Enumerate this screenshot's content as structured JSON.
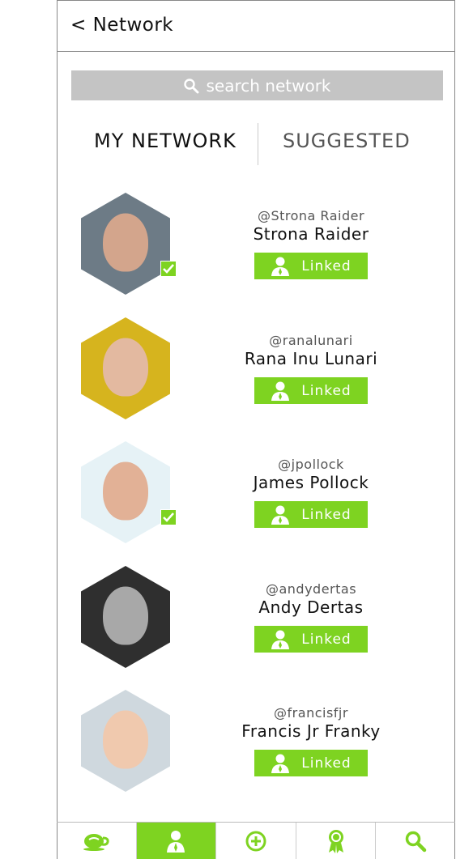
{
  "header": {
    "back_label": "< Network"
  },
  "search": {
    "placeholder": "search network"
  },
  "tabs": [
    {
      "label": "MY NETWORK",
      "active": true
    },
    {
      "label": "SUGGESTED",
      "active": false
    }
  ],
  "network": [
    {
      "handle": "@Strona Raider",
      "name": "Strona Raider",
      "button": "Linked",
      "verified": true,
      "photo_bg": "#6d7b86",
      "photo_face": "#d3a58c"
    },
    {
      "handle": "@ranalunari",
      "name": "Rana Inu Lunari",
      "button": "Linked",
      "verified": false,
      "photo_bg": "#d6b41e",
      "photo_face": "#e3b9a0"
    },
    {
      "handle": "@jpollock",
      "name": "James Pollock",
      "button": "Linked",
      "verified": true,
      "photo_bg": "#e6f2f6",
      "photo_face": "#e2b196"
    },
    {
      "handle": "@andydertas",
      "name": "Andy Dertas",
      "button": "Linked",
      "verified": false,
      "photo_bg": "#2f2f2f",
      "photo_face": "#a8a8a8"
    },
    {
      "handle": "@francisfjr",
      "name": "Francis Jr Franky",
      "button": "Linked",
      "verified": false,
      "photo_bg": "#cfd8de",
      "photo_face": "#f0c9ae"
    }
  ],
  "bottom_nav": [
    {
      "icon": "coffee-cup-icon",
      "active": false
    },
    {
      "icon": "user-network-icon",
      "active": true
    },
    {
      "icon": "plus-circle-icon",
      "active": false
    },
    {
      "icon": "award-ribbon-icon",
      "active": false
    },
    {
      "icon": "search-icon",
      "active": false
    }
  ],
  "colors": {
    "accent": "#7ed321",
    "search_bg": "#c4c4c4"
  }
}
